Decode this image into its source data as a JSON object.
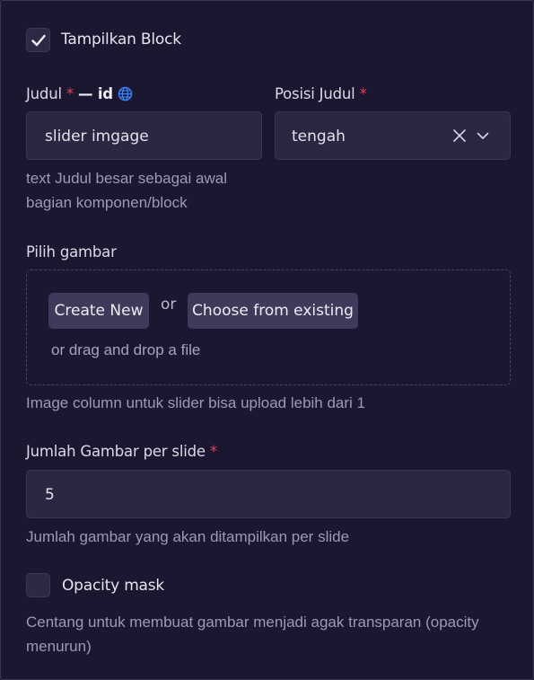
{
  "show_block": {
    "label": "Tampilkan Block",
    "checked": true
  },
  "title_field": {
    "label": "Judul",
    "required_mark": "*",
    "locale": "— id",
    "value": "slider imgage",
    "help": [
      "text Judul besar sebagai awal",
      "bagian komponen/block"
    ]
  },
  "title_position": {
    "label": "Posisi Judul",
    "required_mark": "*",
    "value": "tengah"
  },
  "image_picker": {
    "label": "Pilih gambar",
    "create_new": "Create New",
    "or": "or",
    "choose_existing": "Choose from existing",
    "drag_drop": "or drag and drop a file",
    "help": "Image column untuk slider bisa upload lebih dari 1"
  },
  "images_per_slide": {
    "label": "Jumlah Gambar per slide",
    "required_mark": "*",
    "value": "5",
    "help": "Jumlah gambar yang akan ditampilkan per slide"
  },
  "opacity_mask": {
    "label": "Opacity mask",
    "checked": false,
    "help": [
      "Centang untuk membuat gambar menjadi agak transparan (opacity",
      "menurun)"
    ]
  },
  "colors": {
    "background": "#1b1730",
    "input": "#2b2742",
    "required": "#e0445a",
    "globe": "#3b82f6"
  },
  "icons": [
    "check-icon",
    "globe-icon",
    "clear-x-icon",
    "chevron-down-icon"
  ]
}
